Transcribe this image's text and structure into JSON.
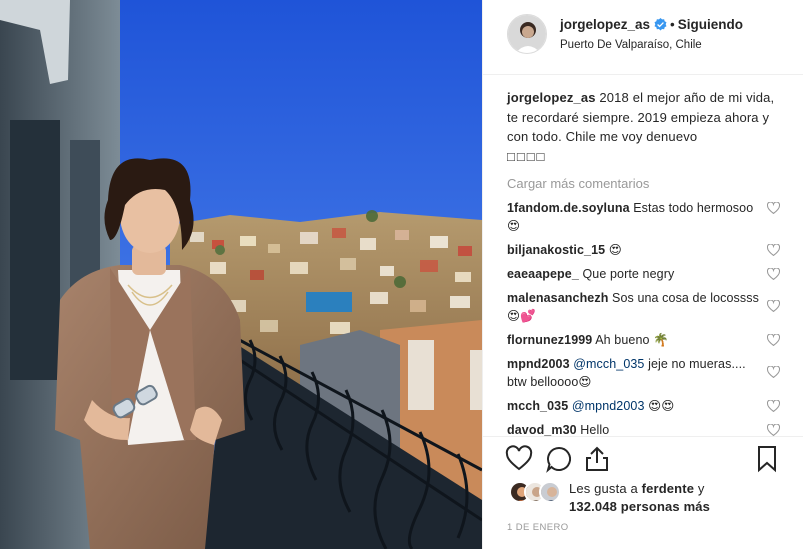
{
  "post": {
    "username": "jorgelopez_as",
    "dot": "•",
    "follow_status": "Siguiendo",
    "location": "Puerto De Valparaíso, Chile",
    "caption_text": "2018 el mejor año de mi vida, te recordaré siempre. 2019 empieza ahora y con todo. Chile me voy denuevo",
    "caption_emoji": "□□□□",
    "load_more": "Cargar más comentarios",
    "comments": [
      {
        "user": "1fandom.de.soyluna",
        "text": "Estas todo hermosoo😍"
      },
      {
        "user": "biljanakostic_15",
        "text": "😍"
      },
      {
        "user": "eaeaapepe_",
        "text": "Que porte negry"
      },
      {
        "user": "malenasanchezh",
        "text": "Sos una cosa de locossss 😍💕"
      },
      {
        "user": "flornunez1999",
        "text": "Ah bueno 🌴"
      },
      {
        "user": "mpnd2003",
        "mention": "@mcch_035",
        "text": "jeje no mueras.... btw belloooo😍"
      },
      {
        "user": "mcch_035",
        "mention": "@mpnd2003",
        "text": "😍😍"
      },
      {
        "user": "davod_m30",
        "text": "Hello"
      }
    ],
    "likes_prefix": "Les gusta a",
    "likes_user": "ferdente",
    "likes_mid": "y",
    "likes_count": "132.048 personas más",
    "date": "1 DE ENERO"
  },
  "icons": [
    "verified-badge-icon",
    "heart-icon",
    "comment-icon",
    "share-icon",
    "bookmark-icon"
  ],
  "colors": {
    "verified": "#3897f0",
    "sky": "#2f63e0",
    "muted": "#999999",
    "link": "#003569"
  }
}
